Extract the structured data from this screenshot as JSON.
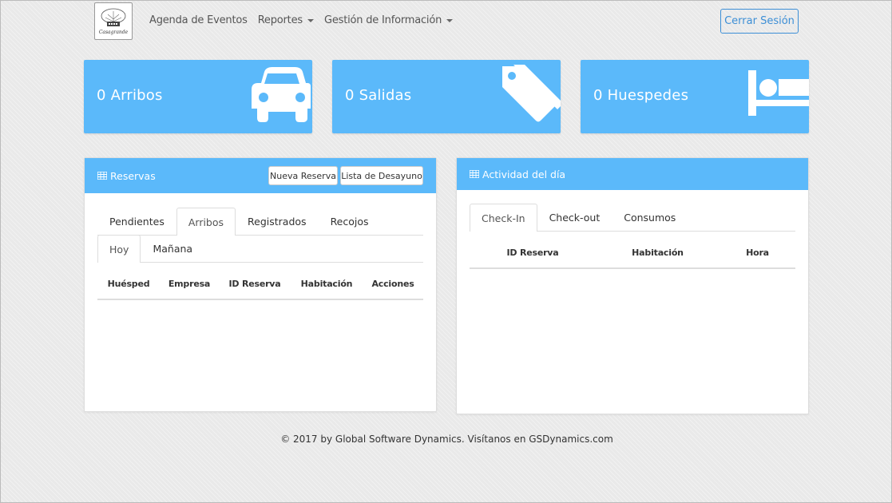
{
  "navbar": {
    "logo_text": "Casagrande",
    "links": [
      {
        "label": "Agenda de Eventos",
        "dropdown": false
      },
      {
        "label": "Reportes",
        "dropdown": true
      },
      {
        "label": "Gestión de Información",
        "dropdown": true
      }
    ],
    "logout_label": "Cerrar Sesión"
  },
  "stats": [
    {
      "label": "0 Arribos",
      "icon": "car-icon"
    },
    {
      "label": "0 Salidas",
      "icon": "tags-icon"
    },
    {
      "label": "0 Huespedes",
      "icon": "bed-icon"
    }
  ],
  "reservas": {
    "title": "Reservas",
    "buttons": {
      "new": "Nueva Reserva",
      "breakfast": "Lista de Desayuno"
    },
    "tabs": [
      "Pendientes",
      "Arribos",
      "Registrados",
      "Recojos"
    ],
    "active_tab": "Arribos",
    "subtabs": [
      "Hoy",
      "Mañana"
    ],
    "active_subtab": "Hoy",
    "columns": [
      "Huésped",
      "Empresa",
      "ID Reserva",
      "Habitación",
      "Acciones"
    ]
  },
  "actividad": {
    "title": "Actividad del día",
    "tabs": [
      "Check-In",
      "Check-out",
      "Consumos"
    ],
    "active_tab": "Check-In",
    "columns": [
      "ID Reserva",
      "Habitación",
      "Hora"
    ]
  },
  "footer": {
    "text": "© 2017 by Global Software Dynamics. Visítanos en GSDynamics.com"
  },
  "colors": {
    "accent": "#5bb9fa",
    "link": "#3d8fd6"
  }
}
